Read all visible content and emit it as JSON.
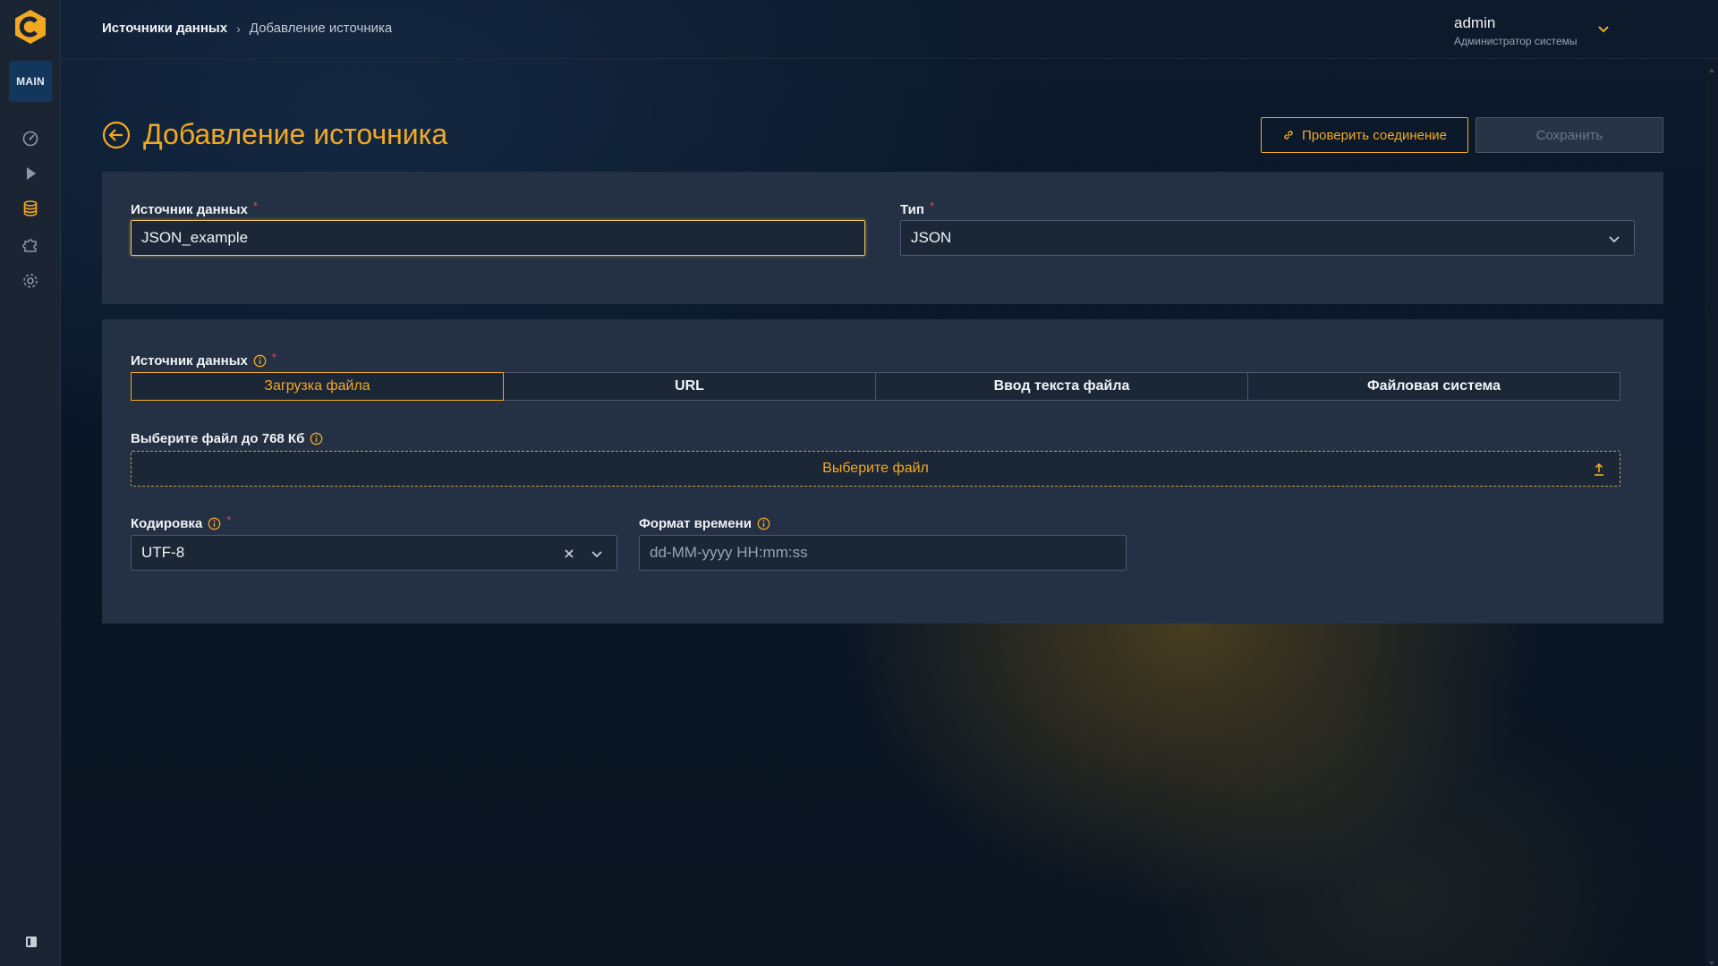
{
  "sidebar": {
    "main_label": "MAIN",
    "icons": [
      "dashboard-icon",
      "play-icon",
      "database-icon",
      "puzzle-icon",
      "gear-icon"
    ],
    "accent": "#f2a922"
  },
  "breadcrumb": {
    "parent": "Источники данных",
    "current": "Добавление источника"
  },
  "user": {
    "name": "admin",
    "role": "Администратор системы"
  },
  "page": {
    "title": "Добавление источника",
    "check_button": "Проверить соединение",
    "save_button": "Сохранить"
  },
  "form": {
    "source_label": "Источник данных",
    "source_value": "JSON_example",
    "type_label": "Тип",
    "type_value": "JSON",
    "required_mark": "*"
  },
  "source_panel": {
    "label": "Источник данных",
    "tabs": [
      "Загрузка файла",
      "URL",
      "Ввод текста файла",
      "Файловая система"
    ],
    "active_tab": 0,
    "file_label": "Выберите файл до 768 Кб",
    "file_button": "Выберите файл",
    "encoding_label": "Кодировка",
    "encoding_value": "UTF-8",
    "time_format_label": "Формат времени",
    "time_format_placeholder": "dd-MM-yyyy HH:mm:ss"
  }
}
